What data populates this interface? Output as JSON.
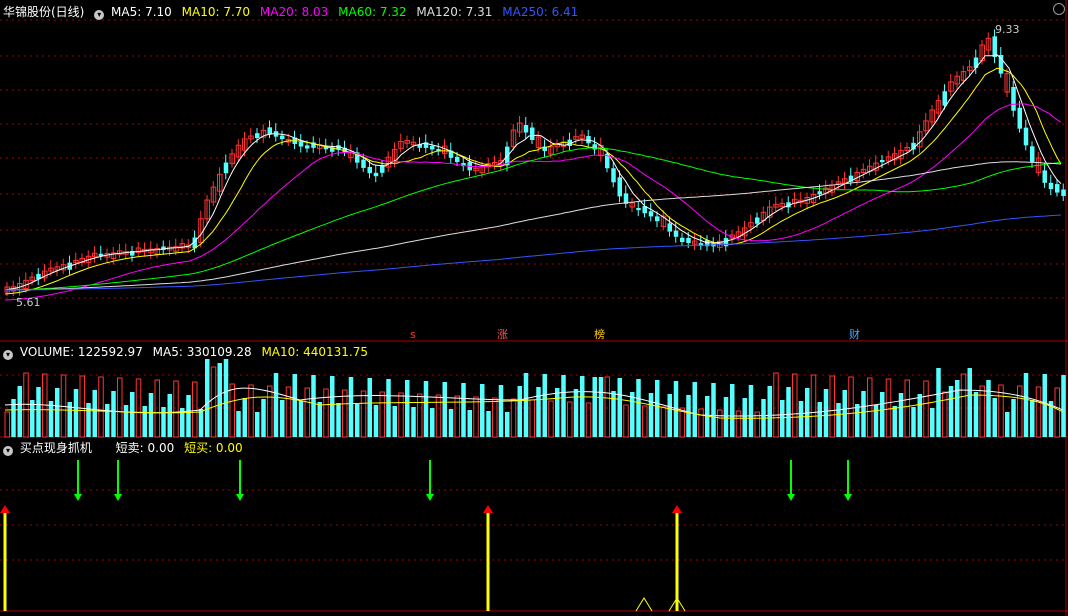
{
  "panel_main": {
    "stock_title": "华锦股份(日线)",
    "ma": [
      {
        "label": "MA5: 7.10",
        "color": "#ffffff"
      },
      {
        "label": "MA10: 7.70",
        "color": "#ffff00"
      },
      {
        "label": "MA20: 8.03",
        "color": "#ff00ff"
      },
      {
        "label": "MA60: 7.32",
        "color": "#00ff00"
      },
      {
        "label": "MA120: 7.31",
        "color": "#dddddd"
      },
      {
        "label": "MA250: 6.41",
        "color": "#3355ff"
      }
    ],
    "high_label": "9.33",
    "low_label": "5.61",
    "events": [
      {
        "text": "s",
        "color": "#ff3333"
      },
      {
        "text": "涨",
        "color": "#ff5555"
      },
      {
        "text": "榜",
        "color": "#ffcc00"
      },
      {
        "text": "财",
        "color": "#4da6ff"
      }
    ]
  },
  "panel_volume": {
    "labels": [
      {
        "text": "VOLUME: 122592.97",
        "color": "#ffffff"
      },
      {
        "text": "MA5: 330109.28",
        "color": "#ffffff"
      },
      {
        "text": "MA10: 440131.75",
        "color": "#ffff00"
      }
    ]
  },
  "panel_indicator": {
    "title": "买点现身抓机",
    "short_sell": "短卖: 0.00",
    "short_buy": "短买: 0.00"
  },
  "colors": {
    "up": "#ff3333",
    "down": "#54ffff",
    "buy_arrow": "#ff0000",
    "sell_arrow": "#00ff00",
    "spike": "#ffff00",
    "grid": "#a00000"
  }
}
